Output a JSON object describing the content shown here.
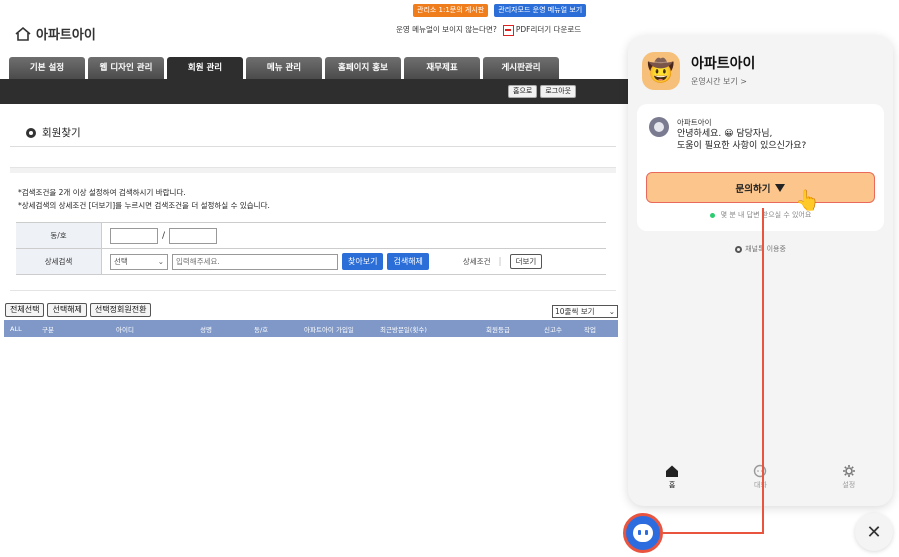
{
  "header": {
    "site_name": "아파트아이",
    "badge_admin_board": "관리소 1:1문의 게시판",
    "badge_admin_menu": "관리자모드 운영 메뉴얼 보기",
    "menu_missing": "운영 메뉴얼이 보이지 않는다면?",
    "pdf_download": "PDF리더기 다운로드"
  },
  "nav": {
    "tabs": [
      {
        "label": "기본 설정"
      },
      {
        "label": "웹 디자인 관리"
      },
      {
        "label": "회원 관리"
      },
      {
        "label": "메뉴 관리"
      },
      {
        "label": "홈페이지 홍보"
      },
      {
        "label": "재무제표"
      },
      {
        "label": "게시판관리"
      }
    ],
    "home_button": "홈으로",
    "logout_button": "로그아웃"
  },
  "page": {
    "title": "회원찾기",
    "note1": "*검색조건을 2개 이상 설정하여 검색하시기 바랍니다.",
    "note2": "*상세검색의 상세조건 [더보기]를 누르시면 검색조건을 더 설정하실 수 있습니다."
  },
  "search": {
    "dong_label": "동/호",
    "dong_separator": "/",
    "detail_label": "상세검색",
    "select_value": "선택",
    "input_placeholder": "입력해주세요.",
    "find_button": "찾아보기",
    "reset_button": "검색해제",
    "condition_label": "상세조건",
    "more_button": "더보기"
  },
  "list": {
    "select_all": "전체선택",
    "deselect": "선택해제",
    "convert": "선택정회원전환",
    "per_page": "10줄씩 보기",
    "columns": [
      "ALL",
      "구분",
      "아이디",
      "성명",
      "동/호",
      "아파트아이 가입일",
      "최근방문일(횟수)",
      "회원등급",
      "신고수",
      "작업"
    ]
  },
  "chat": {
    "name": "아파트아이",
    "hours_link": "운영시간 보기 >",
    "sender": "아파트아이",
    "msg_line1": "안녕하세요. 😀 담당자님,",
    "msg_line2": "도움이 필요한 사항이 있으신가요?",
    "inquiry_button": "문의하기",
    "reply_note": "몇 분 내 답변 받으실 수 있어요",
    "channel_note": "채널톡 이용중",
    "nav_home": "홈",
    "nav_chat": "대화",
    "nav_settings": "설정",
    "close_symbol": "✕"
  },
  "colors": {
    "nav_dark": "#2e2e2e",
    "table_header": "#7f98c8",
    "accent_blue": "#2b6ed8",
    "inquiry_orange": "#fbc58c",
    "annotation_red": "#e9543f"
  }
}
